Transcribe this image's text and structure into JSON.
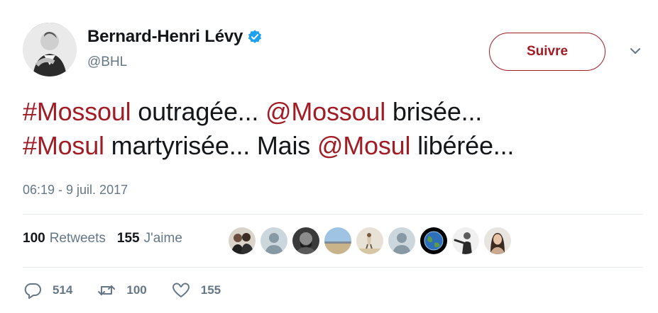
{
  "author": {
    "name": "Bernard-Henri Lévy",
    "handle": "@BHL",
    "verified_color": "#1da1f2"
  },
  "follow_label": "Suivre",
  "tweet": {
    "segments": [
      {
        "text": "#Mossoul",
        "link": true
      },
      {
        "text": " outragée... ",
        "link": false
      },
      {
        "text": "@Mossoul",
        "link": true
      },
      {
        "text": " brisée... ",
        "link": false
      },
      {
        "text": "#Mosul",
        "link": true
      },
      {
        "text": " martyrisée... Mais ",
        "link": false
      },
      {
        "text": "@Mosul",
        "link": true
      },
      {
        "text": " libérée...",
        "link": false
      }
    ],
    "link_color": "#a11c24"
  },
  "timestamp": "06:19 - 9 juil. 2017",
  "stats": {
    "retweets_count": "100",
    "retweets_label": "Retweets",
    "likes_count": "155",
    "likes_label": "J'aime"
  },
  "likers": [
    {
      "icon": "two-people-photo"
    },
    {
      "icon": "default-avatar"
    },
    {
      "icon": "bearded-man-photo"
    },
    {
      "icon": "sky-landscape-photo"
    },
    {
      "icon": "beach-figure-photo"
    },
    {
      "icon": "default-avatar"
    },
    {
      "icon": "earth-globe-photo"
    },
    {
      "icon": "person-pointing-photo"
    },
    {
      "icon": "woman-portrait-photo"
    }
  ],
  "actions": {
    "reply_count": "514",
    "retweet_count": "100",
    "like_count": "155"
  },
  "colors": {
    "text": "#14171a",
    "secondary": "#657786",
    "accent": "#a11c24",
    "divider": "#e6ecf0"
  }
}
